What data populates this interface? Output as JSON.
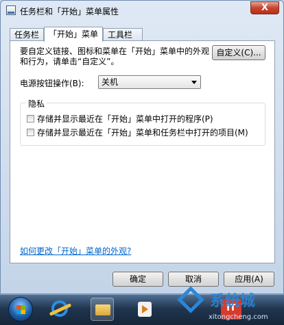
{
  "window": {
    "title": "任务栏和「开始」菜单属性",
    "close_symbol": "X"
  },
  "tabs": [
    {
      "label": "任务栏",
      "active": false
    },
    {
      "label": "「开始」菜单",
      "active": true
    },
    {
      "label": "工具栏",
      "active": false
    }
  ],
  "start_menu": {
    "instruction": "要自定义链接、图标和菜单在「开始」菜单中的外观和行为，请单击“自定义”。",
    "customize_button": "自定义(C)...",
    "power_label": "电源按钮操作(B):",
    "power_value": "关机",
    "privacy": {
      "label": "隐私",
      "options": [
        {
          "label": "存储并显示最近在「开始」菜单中打开的程序(P)",
          "checked": false
        },
        {
          "label": "存储并显示最近在「开始」菜单和任务栏中打开的项目(M)",
          "checked": false
        }
      ]
    },
    "help_link": "如何更改「开始」菜单的外观?"
  },
  "buttons": {
    "ok": "确定",
    "cancel": "取消",
    "apply": "应用(A)"
  },
  "taskbar": {
    "icons": [
      "start-orb-icon",
      "internet-explorer-icon",
      "folder-icon",
      "media-player-icon",
      "app-icon"
    ]
  },
  "watermark": {
    "brand": "系统城",
    "domain": "xitongcheng.com"
  }
}
